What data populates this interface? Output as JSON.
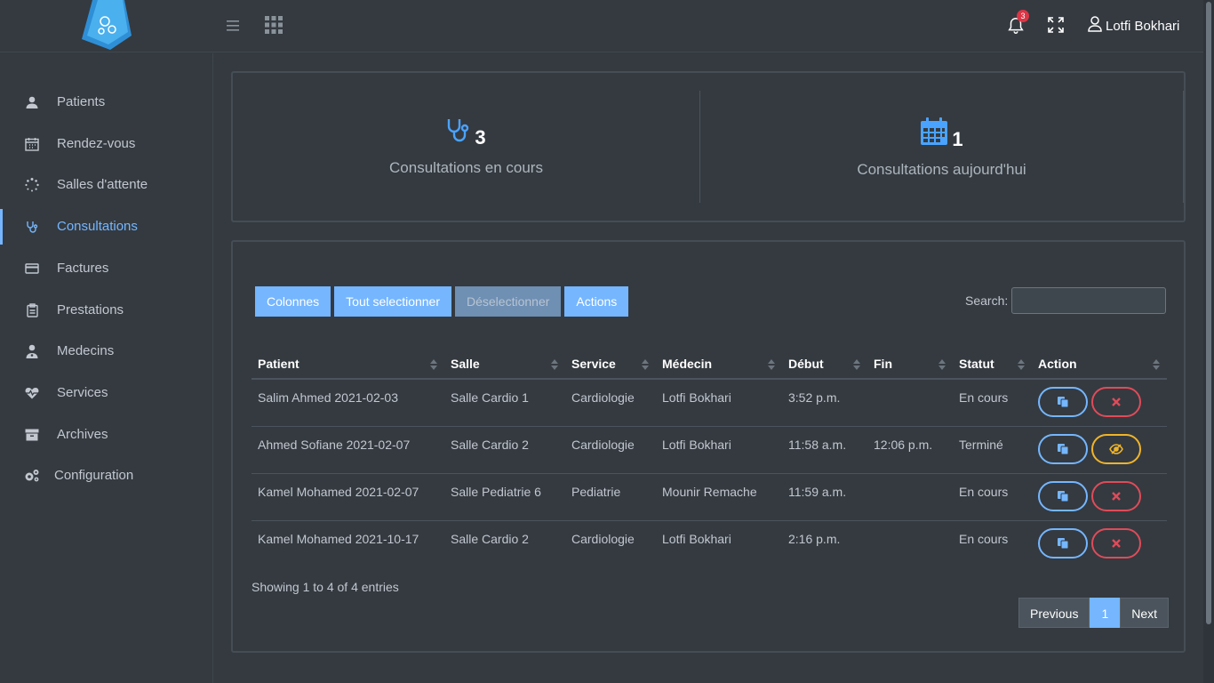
{
  "header": {
    "notification_count": "3",
    "user_name": "Lotfi Bokhari"
  },
  "sidebar": {
    "items": [
      {
        "label": "Patients"
      },
      {
        "label": "Rendez-vous"
      },
      {
        "label": "Salles d'attente"
      },
      {
        "label": "Consultations"
      },
      {
        "label": "Factures"
      },
      {
        "label": "Prestations"
      },
      {
        "label": "Medecins"
      },
      {
        "label": "Services"
      },
      {
        "label": "Archives"
      },
      {
        "label": "Configuration"
      }
    ]
  },
  "stats": {
    "in_progress": {
      "value": "3",
      "caption": "Consultations en cours"
    },
    "today": {
      "value": "1",
      "caption": "Consultations aujourd'hui"
    }
  },
  "toolbar": {
    "columns": "Colonnes",
    "select_all": "Tout selectionner",
    "deselect": "Déselectionner",
    "actions": "Actions",
    "search_label": "Search:",
    "search_value": ""
  },
  "table": {
    "headers": [
      "Patient",
      "Salle",
      "Service",
      "Médecin",
      "Début",
      "Fin",
      "Statut",
      "Action"
    ],
    "rows": [
      {
        "patient": "Salim Ahmed 2021-02-03",
        "salle": "Salle Cardio 1",
        "service": "Cardiologie",
        "medecin": "Lotfi Bokhari",
        "debut": "3:52 p.m.",
        "fin": "",
        "statut": "En cours"
      },
      {
        "patient": "Ahmed Sofiane 2021-02-07",
        "salle": "Salle Cardio 2",
        "service": "Cardiologie",
        "medecin": "Lotfi Bokhari",
        "debut": "11:58 a.m.",
        "fin": "12:06 p.m.",
        "statut": "Terminé"
      },
      {
        "patient": "Kamel Mohamed 2021-02-07",
        "salle": "Salle Pediatrie 6",
        "service": "Pediatrie",
        "medecin": "Mounir Remache",
        "debut": "11:59 a.m.",
        "fin": "",
        "statut": "En cours"
      },
      {
        "patient": "Kamel Mohamed 2021-10-17",
        "salle": "Salle Cardio 2",
        "service": "Cardiologie",
        "medecin": "Lotfi Bokhari",
        "debut": "2:16 p.m.",
        "fin": "",
        "statut": "En cours"
      }
    ]
  },
  "footer": {
    "info": "Showing 1 to 4 of 4 entries",
    "previous": "Previous",
    "page": "1",
    "next": "Next"
  },
  "colors": {
    "accent": "#75b6ff",
    "danger": "#e04b59",
    "warning": "#f0b429",
    "background": "#343a40"
  }
}
